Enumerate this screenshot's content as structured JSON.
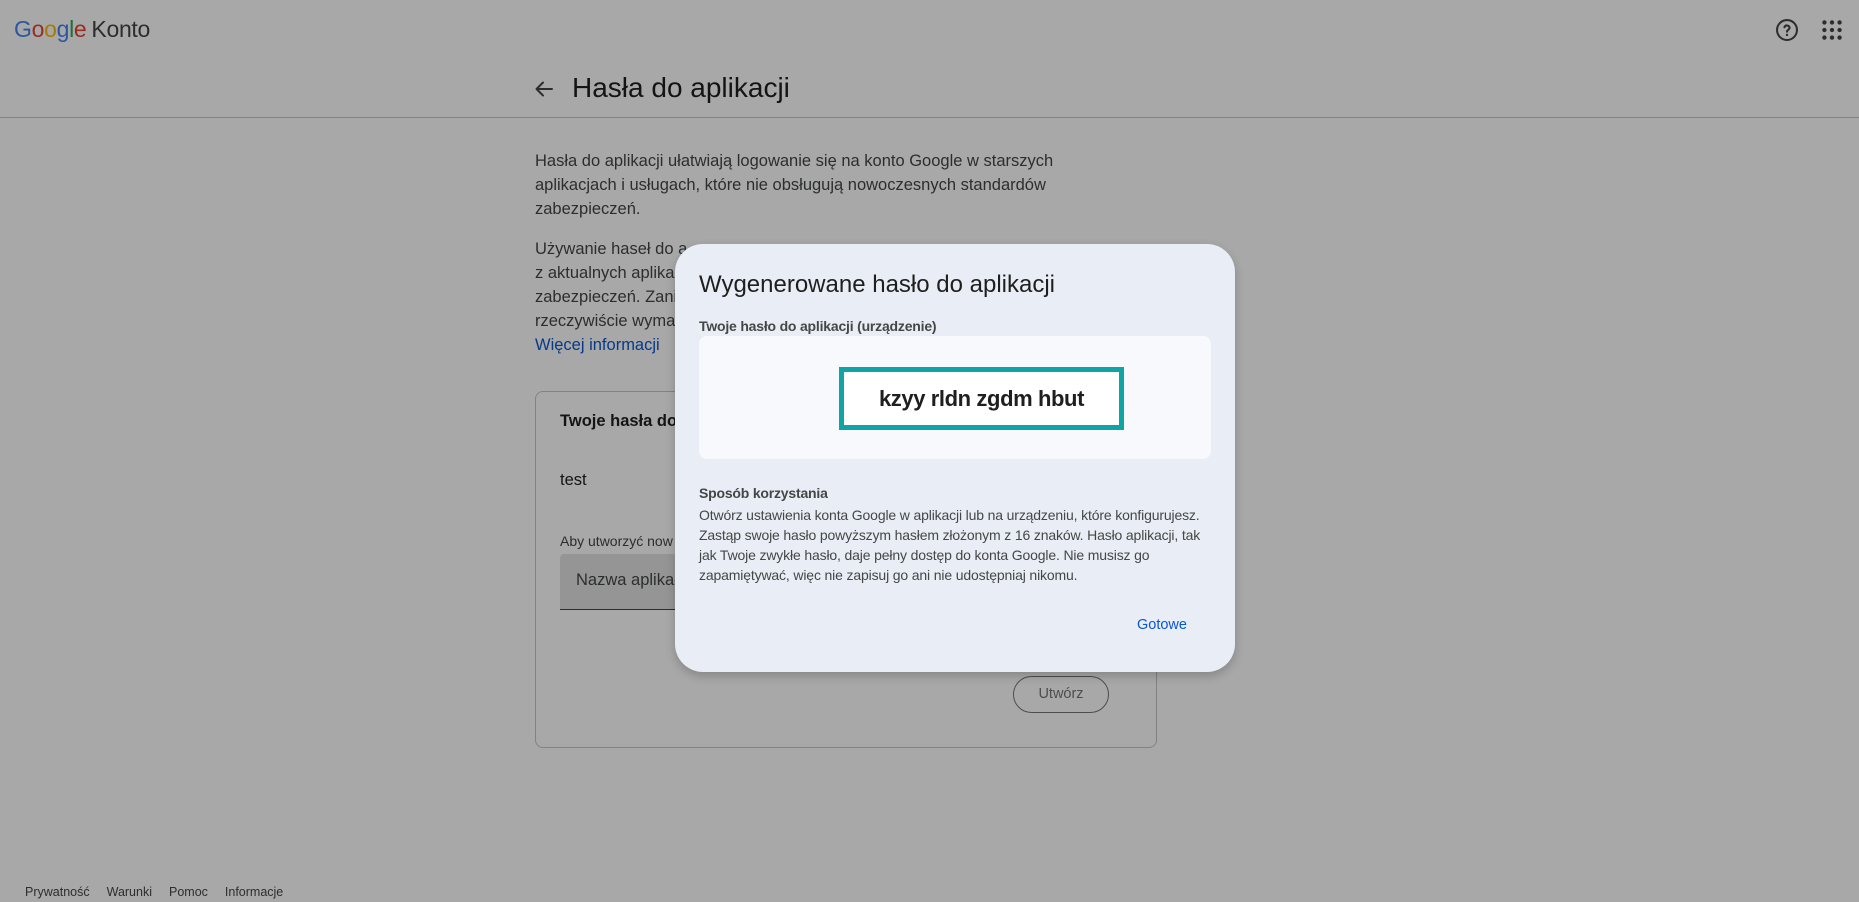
{
  "header": {
    "logo_letters": [
      "G",
      "o",
      "o",
      "g",
      "l",
      "e"
    ],
    "logo_suffix": "Konto",
    "help_icon": "help-circle-icon",
    "apps_icon": "apps-grid-icon"
  },
  "page": {
    "title": "Hasła do aplikacji",
    "back_icon": "arrow-back-icon",
    "intro": "Hasła do aplikacji ułatwiają logowanie się na konto Google w starszych aplikacjach i usługach, które nie obsługują nowoczesnych standardów zabezpieczeń.",
    "warning_lines": [
      "Używanie haseł do a",
      "z aktualnych aplika",
      "zabezpieczeń. Zani",
      "rzeczywiście wyma"
    ],
    "more_link": "Więcej informacji"
  },
  "card": {
    "title": "Twoje hasła do",
    "app_name": "test",
    "create_hint": "Aby utworzyć now",
    "input_placeholder": "Nazwa aplikac",
    "create_button": "Utwórz"
  },
  "footer": {
    "links": [
      "Prywatność",
      "Warunki",
      "Pomoc",
      "Informacje"
    ]
  },
  "dialog": {
    "title": "Wygenerowane hasło do aplikacji",
    "password_label": "Twoje hasło do aplikacji (urządzenie)",
    "password": "kzyy rldn zgdm hbut",
    "how_label": "Sposób korzystania",
    "how_text": "Otwórz ustawienia konta Google w aplikacji lub na urządzeniu, które konfigurujesz. Zastąp swoje hasło powyższym hasłem złożonym z 16 znaków. Hasło aplikacji, tak jak Twoje zwykłe hasło, daje pełny dostęp do konta Google. Nie musisz go zapamiętywać, więc nie zapisuj go ani nie udostępniaj nikomu.",
    "done_button": "Gotowe"
  },
  "colors": {
    "accent_blue": "#0b57d0",
    "password_frame": "#12a4a4",
    "dialog_bg": "#e9eef6"
  }
}
